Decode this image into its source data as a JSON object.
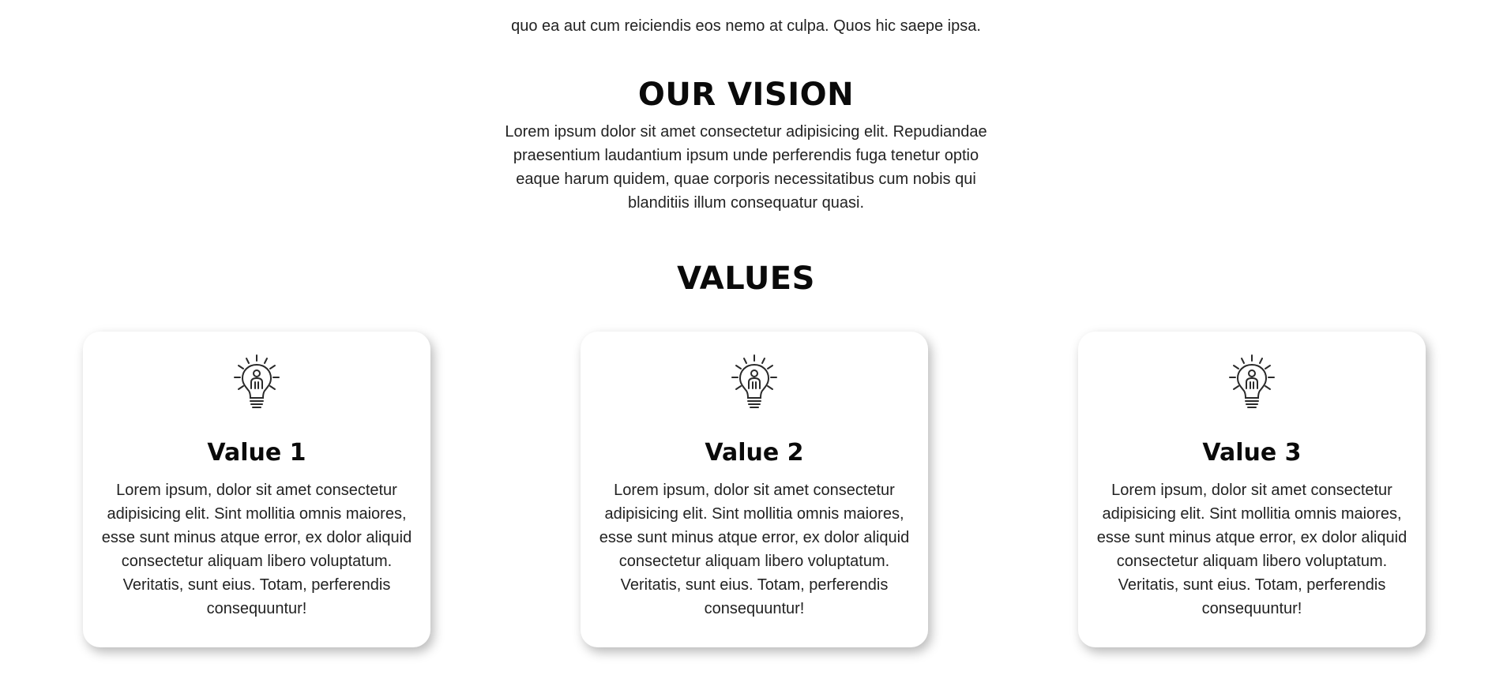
{
  "mission": {
    "tail_line": "quo ea aut cum reiciendis eos nemo at culpa. Quos hic saepe ipsa."
  },
  "vision": {
    "title": "OUR VISION",
    "text": "Lorem ipsum dolor sit amet consectetur adipisicing elit. Repudiandae praesentium laudantium ipsum unde perferendis fuga tenetur optio eaque harum quidem, quae corporis necessitatibus cum nobis qui blanditiis illum consequatur quasi."
  },
  "values": {
    "title": "VALUES",
    "icon": "lightbulb-person-icon",
    "cards": [
      {
        "title": "Value 1",
        "text": "Lorem ipsum, dolor sit amet consectetur adipisicing elit. Sint mollitia omnis maiores, esse sunt minus atque error, ex dolor aliquid consectetur aliquam libero voluptatum. Veritatis, sunt eius. Totam, perferendis consequuntur!"
      },
      {
        "title": "Value 2",
        "text": "Lorem ipsum, dolor sit amet consectetur adipisicing elit. Sint mollitia omnis maiores, esse sunt minus atque error, ex dolor aliquid consectetur aliquam libero voluptatum. Veritatis, sunt eius. Totam, perferendis consequuntur!"
      },
      {
        "title": "Value 3",
        "text": "Lorem ipsum, dolor sit amet consectetur adipisicing elit. Sint mollitia omnis maiores, esse sunt minus atque error, ex dolor aliquid consectetur aliquam libero voluptatum. Veritatis, sunt eius. Totam, perferendis consequuntur!"
      }
    ]
  },
  "colors": {
    "background": "#ffffff",
    "text": "#222222",
    "heading": "#0a0a0a"
  }
}
